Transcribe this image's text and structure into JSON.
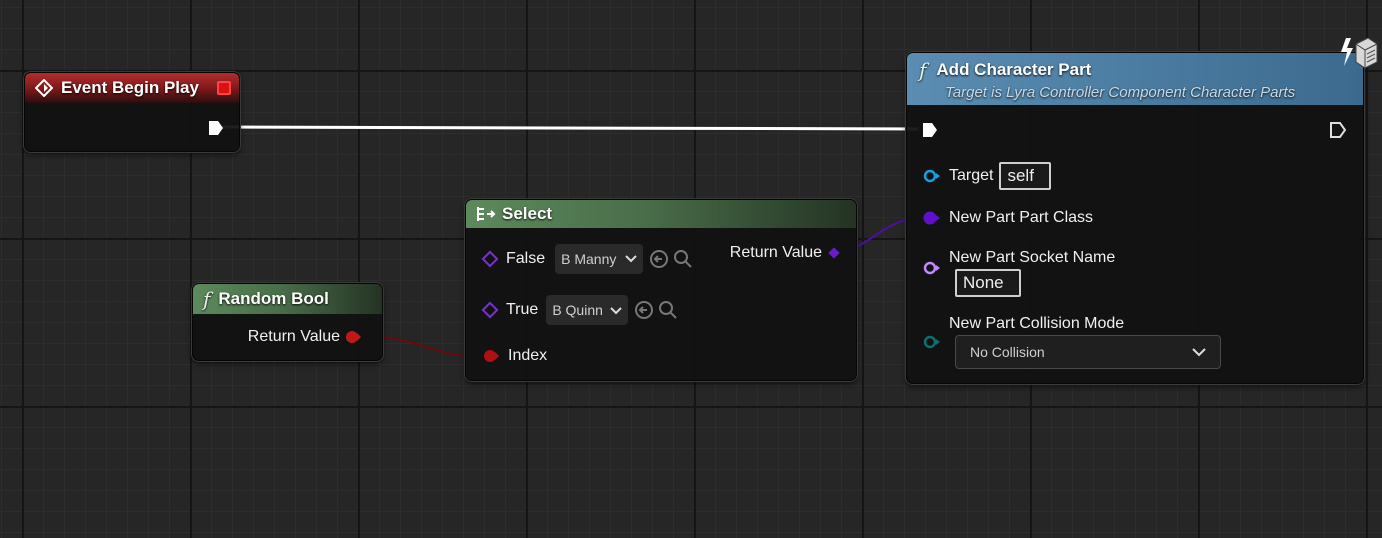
{
  "colors": {
    "exec": "#ffffff",
    "boolean": "#8c0000",
    "class": "#5a00b8",
    "object": "#0f86c8",
    "name": "#c787ff",
    "enum": "#006e6e"
  },
  "nodes": {
    "event_begin_play": {
      "title": "Event Begin Play",
      "icon": "event-diamond-icon",
      "badge_icon": "red-square-icon"
    },
    "random_bool": {
      "title": "Random Bool",
      "icon": "function-icon",
      "return_label": "Return Value"
    },
    "select": {
      "title": "Select",
      "icon": "select-icon",
      "false_label": "False",
      "false_value": "B Manny",
      "true_label": "True",
      "true_value": "B Quinn",
      "index_label": "Index",
      "return_label": "Return Value"
    },
    "add_character_part": {
      "title": "Add Character Part",
      "subtitle": "Target is Lyra Controller Component Character Parts",
      "icon": "function-icon",
      "target_label": "Target",
      "target_value": "self",
      "part_class_label": "New Part Part Class",
      "socket_label": "New Part Socket Name",
      "socket_value": "None",
      "collision_label": "New Part Collision Mode",
      "collision_value": "No Collision",
      "corner_icon": "server-lightning-icon"
    }
  }
}
